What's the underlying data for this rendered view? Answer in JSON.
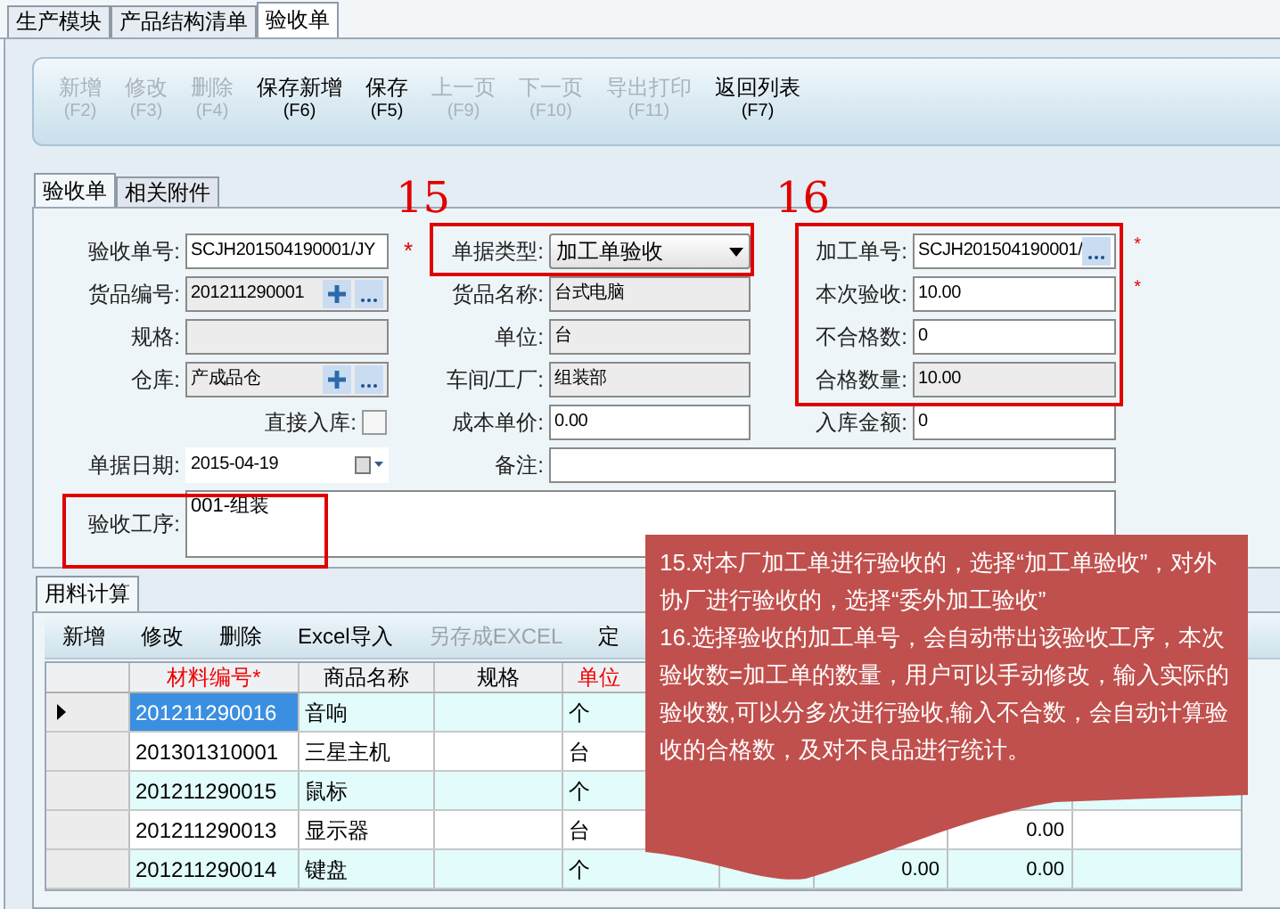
{
  "module_tabs": [
    {
      "label": "生产模块",
      "selected": false
    },
    {
      "label": "产品结构清单",
      "selected": false
    },
    {
      "label": "验收单",
      "selected": true
    }
  ],
  "toolbar": [
    {
      "label": "新增",
      "shortcut": "(F2)",
      "disabled": true
    },
    {
      "label": "修改",
      "shortcut": "(F3)",
      "disabled": true
    },
    {
      "label": "删除",
      "shortcut": "(F4)",
      "disabled": true
    },
    {
      "label": "保存新增",
      "shortcut": "(F6)",
      "disabled": false
    },
    {
      "label": "保存",
      "shortcut": "(F5)",
      "disabled": false
    },
    {
      "label": "上一页",
      "shortcut": "(F9)",
      "disabled": true
    },
    {
      "label": "下一页",
      "shortcut": "(F10)",
      "disabled": true
    },
    {
      "label": "导出打印",
      "shortcut": "(F11)",
      "disabled": true
    },
    {
      "label": "返回列表",
      "shortcut": "(F7)",
      "disabled": false
    }
  ],
  "form_tabs": [
    {
      "label": "验收单",
      "selected": true
    },
    {
      "label": "相关附件",
      "selected": false
    }
  ],
  "form_rows": [
    [
      {
        "label": "验收单号:",
        "kind": "text",
        "value": "SCJH201504190001/JY",
        "mark": "*"
      },
      {
        "label": "单据类型:",
        "kind": "select",
        "value": "加工单验收"
      },
      {
        "label": "加工单号:",
        "kind": "browse",
        "value": "SCJH201504190001/",
        "mark": "*"
      }
    ],
    [
      {
        "label": "货品编号:",
        "kind": "lookup",
        "value": "201211290001"
      },
      {
        "label": "货品名称:",
        "kind": "readonly",
        "value": "台式电脑"
      },
      {
        "label": "本次验收:",
        "kind": "text",
        "value": "10.00",
        "mark": "*"
      }
    ],
    [
      {
        "label": "规格:",
        "kind": "readonly"
      },
      {
        "label": "单位:",
        "kind": "readonly",
        "value": "台"
      },
      {
        "label": "不合格数:",
        "kind": "text",
        "value": "0"
      }
    ],
    [
      {
        "label": "仓库:",
        "kind": "lookup",
        "value": "产成品仓"
      },
      {
        "label": "车间/工厂:",
        "kind": "readonly",
        "value": "组装部"
      },
      {
        "label": "合格数量:",
        "kind": "readonly",
        "value": "10.00"
      }
    ],
    [
      {
        "label": "直接入库:",
        "kind": "checkbox",
        "checked": false
      },
      {
        "label": "成本单价:",
        "kind": "text",
        "value": "0.00"
      },
      {
        "label": "入库金额:",
        "kind": "text",
        "value": "0"
      }
    ],
    [
      {
        "label": "单据日期:",
        "kind": "date",
        "value": "2015-04-19"
      },
      {
        "label": "备注:",
        "kind": "wide"
      }
    ],
    [
      {
        "label": "验收工序:",
        "kind": "textarea",
        "value": "001-组装"
      }
    ]
  ],
  "annotations": [
    {
      "number": "15"
    },
    {
      "number": "16"
    }
  ],
  "detail_tab": {
    "label": "用料计算",
    "selected": true
  },
  "detail_toolbar": [
    {
      "label": "新增",
      "disabled": false
    },
    {
      "label": "修改",
      "disabled": false
    },
    {
      "label": "删除",
      "disabled": false
    },
    {
      "label": "Excel导入",
      "disabled": false
    },
    {
      "label": "另存成EXCEL",
      "disabled": true
    },
    {
      "label": "定",
      "disabled": false
    }
  ],
  "table": {
    "columns": [
      {
        "label": "材料编号*",
        "required": true
      },
      {
        "label": "商品名称",
        "required": false
      },
      {
        "label": "规格",
        "required": false
      },
      {
        "label": "单位",
        "required": true
      }
    ],
    "rows": [
      {
        "selected": true,
        "cells": [
          "201211290016",
          "音响",
          "",
          "个"
        ]
      },
      {
        "selected": false,
        "cells": [
          "201301310001",
          "三星主机",
          "",
          "台"
        ]
      },
      {
        "selected": false,
        "cells": [
          "201211290015",
          "鼠标",
          "",
          "个"
        ]
      },
      {
        "selected": false,
        "cells": [
          "201211290013",
          "显示器",
          "",
          "台"
        ],
        "column_7": "0.00"
      },
      {
        "selected": false,
        "cells": [
          "201211290014",
          "键盘",
          "",
          "个"
        ],
        "column_6": "0.00",
        "column_7": "0.00"
      }
    ]
  },
  "callout": [
    "15.对本厂加工单进行验收的，选择“加工单验收”，对外协厂进行验收的，选择“委外加工验收”",
    "16.选择验收的加工单号，会自动带出该验收工序，本次验收数=加工单的数量，用户可以手动修改，输入实际的验收数,可以分多次进行验收,输入不合数，会自动计算验收的合格数，及对不良品进行统计。"
  ]
}
